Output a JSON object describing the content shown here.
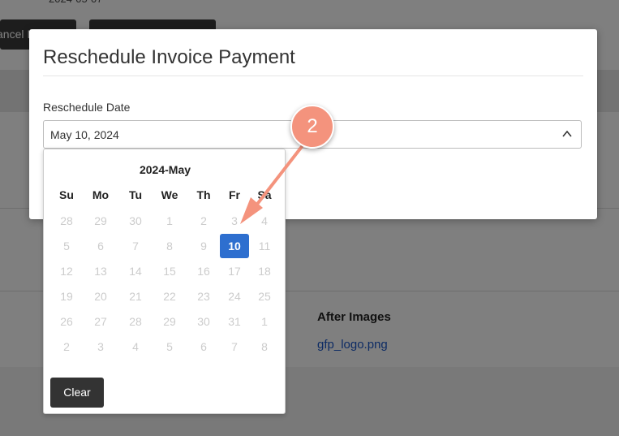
{
  "background": {
    "date_fragment": "2024-05-07",
    "cancel_button_fragment": "ancel I",
    "after_images_label": "After Images",
    "after_image_file": "gfp_logo.png"
  },
  "modal": {
    "title": "Reschedule Invoice Payment",
    "field_label": "Reschedule Date",
    "date_value": "May 10, 2024",
    "calendar": {
      "title": "2024-May",
      "weekdays": [
        "Su",
        "Mo",
        "Tu",
        "We",
        "Th",
        "Fr",
        "Sa"
      ],
      "weeks": [
        [
          "28",
          "29",
          "30",
          "1",
          "2",
          "3",
          "4"
        ],
        [
          "5",
          "6",
          "7",
          "8",
          "9",
          "10",
          "11"
        ],
        [
          "12",
          "13",
          "14",
          "15",
          "16",
          "17",
          "18"
        ],
        [
          "19",
          "20",
          "21",
          "22",
          "23",
          "24",
          "25"
        ],
        [
          "26",
          "27",
          "28",
          "29",
          "30",
          "31",
          "1"
        ],
        [
          "2",
          "3",
          "4",
          "5",
          "6",
          "7",
          "8"
        ]
      ],
      "selected_day": "10",
      "selected_color": "#2e6fcf",
      "clear_label": "Clear"
    }
  },
  "annotation": {
    "step_number": "2",
    "badge_color": "#f4937d"
  },
  "icons": {
    "input_chevron": "chevron-up-icon"
  }
}
